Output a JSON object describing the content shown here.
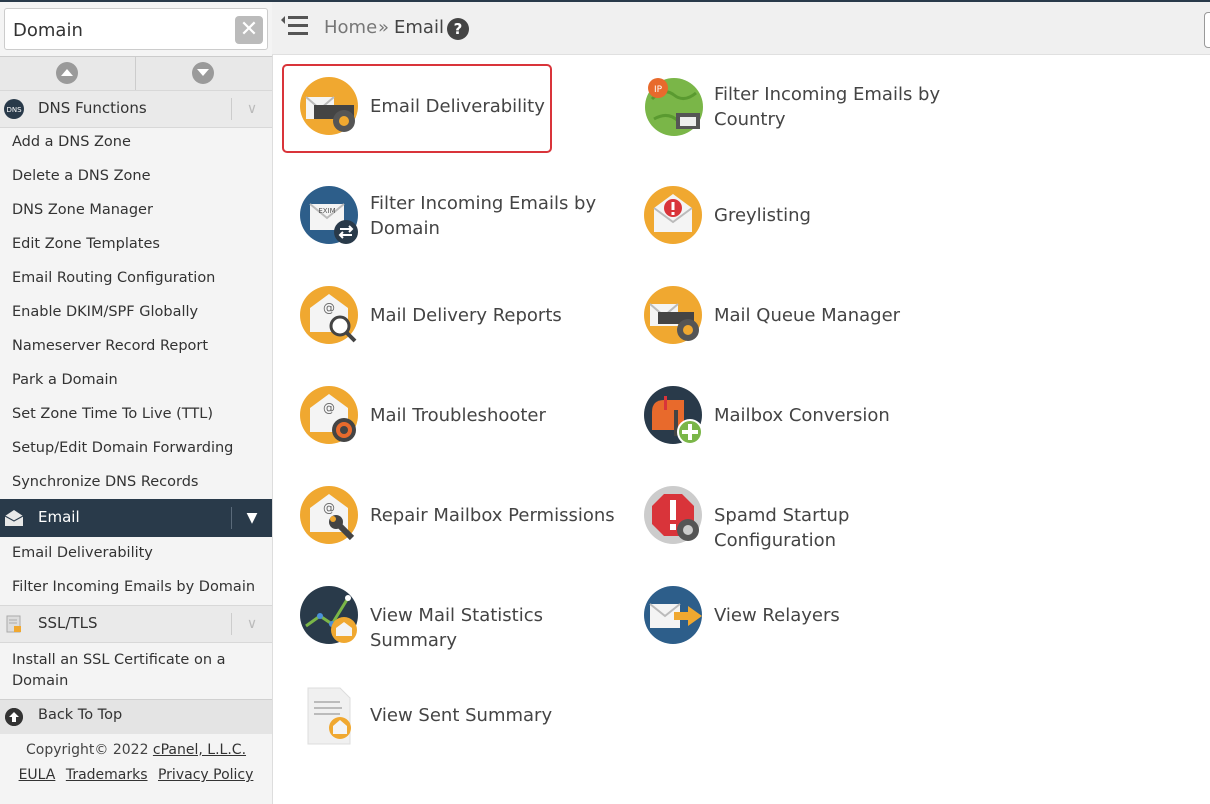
{
  "sidebar": {
    "search": {
      "value": "Domain",
      "clear_icon": "close-icon"
    },
    "sections": [
      {
        "label": "DNS Functions",
        "icon": "dns-icon",
        "items": [
          "Add a DNS Zone",
          "Delete a DNS Zone",
          "DNS Zone Manager",
          "Edit Zone Templates",
          "Email Routing Configuration",
          "Enable DKIM/SPF Globally",
          "Nameserver Record Report",
          "Park a Domain",
          "Set Zone Time To Live (TTL)",
          "Setup/Edit Domain Forwarding",
          "Synchronize DNS Records"
        ]
      },
      {
        "label": "Email",
        "icon": "email-icon",
        "active": true,
        "items": [
          "Email Deliverability",
          "Filter Incoming Emails by Domain"
        ]
      },
      {
        "label": "SSL/TLS",
        "icon": "ssl-icon",
        "items": [
          "Install an SSL Certificate on a Domain"
        ]
      }
    ],
    "back_to_top": "Back To Top",
    "footer": {
      "copyright": "Copyright© 2022 ",
      "company": "cPanel, L.L.C.",
      "links": [
        "EULA",
        "Trademarks",
        "Privacy Policy"
      ]
    }
  },
  "header": {
    "breadcrumb_home": "Home",
    "breadcrumb_sep": "»",
    "breadcrumb_current": "Email",
    "help_icon": "?"
  },
  "main": {
    "items": [
      {
        "label": "Email Deliverability",
        "icon": "envelope-gear-icon",
        "highlighted": true
      },
      {
        "label": "Filter Incoming Emails by Country",
        "icon": "globe-ip-icon"
      },
      {
        "label": "Filter Incoming Emails by Domain",
        "icon": "exim-envelope-icon"
      },
      {
        "label": "Greylisting",
        "icon": "envelope-alert-icon"
      },
      {
        "label": "Mail Delivery Reports",
        "icon": "envelope-search-icon"
      },
      {
        "label": "Mail Queue Manager",
        "icon": "envelope-queue-gear-icon"
      },
      {
        "label": "Mail Troubleshooter",
        "icon": "envelope-lifebuoy-icon"
      },
      {
        "label": "Mailbox Conversion",
        "icon": "mailbox-plus-icon"
      },
      {
        "label": "Repair Mailbox Permissions",
        "icon": "envelope-wrench-icon"
      },
      {
        "label": "Spamd Startup Configuration",
        "icon": "stop-sign-gear-icon"
      },
      {
        "label": "View Mail Statistics Summary",
        "icon": "stats-graph-icon"
      },
      {
        "label": "View Relayers",
        "icon": "envelope-arrow-icon"
      },
      {
        "label": "View Sent Summary",
        "icon": "document-envelope-icon"
      }
    ]
  },
  "colors": {
    "accent_orange": "#f0a830",
    "dark_navy": "#293a4a",
    "highlight_red": "#d9343a",
    "green": "#7ab648"
  }
}
